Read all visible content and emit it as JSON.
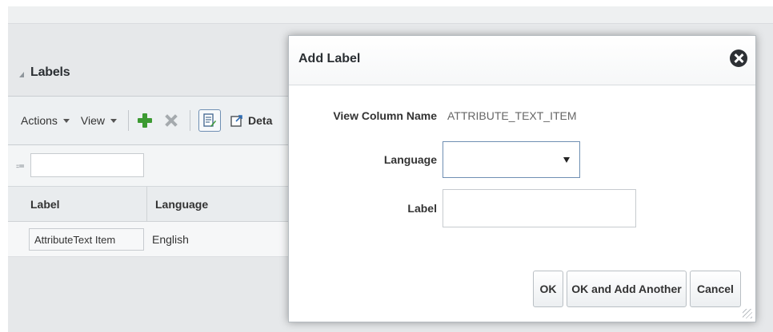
{
  "background": {
    "section_title": "Labels",
    "toolbar": {
      "actions_label": "Actions",
      "view_label": "View",
      "detach_label": "Deta"
    },
    "filter": {
      "value": ""
    },
    "table": {
      "columns": [
        "Label",
        "Language"
      ],
      "rows": [
        {
          "label": "AttributeText Item",
          "language": "English"
        }
      ]
    }
  },
  "dialog": {
    "title": "Add Label",
    "view_column_name_label": "View Column Name",
    "view_column_name_value": "ATTRIBUTE_TEXT_ITEM",
    "language_label": "Language",
    "language_value": "",
    "label_label": "Label",
    "label_value": "",
    "buttons": {
      "ok": "OK",
      "ok_add_another": "OK and Add Another",
      "cancel": "Cancel"
    }
  },
  "colors": {
    "accent_border": "#6f8fb3",
    "add_icon_green": "#3c9a32",
    "close_icon_dark": "#2d3034"
  },
  "icons": {
    "add": "plus-icon",
    "delete": "x-icon",
    "edit": "edit-icon",
    "detach": "detach-icon",
    "close": "close-icon",
    "collapse": "collapse-triangle-icon",
    "filter": "filter-icon"
  }
}
